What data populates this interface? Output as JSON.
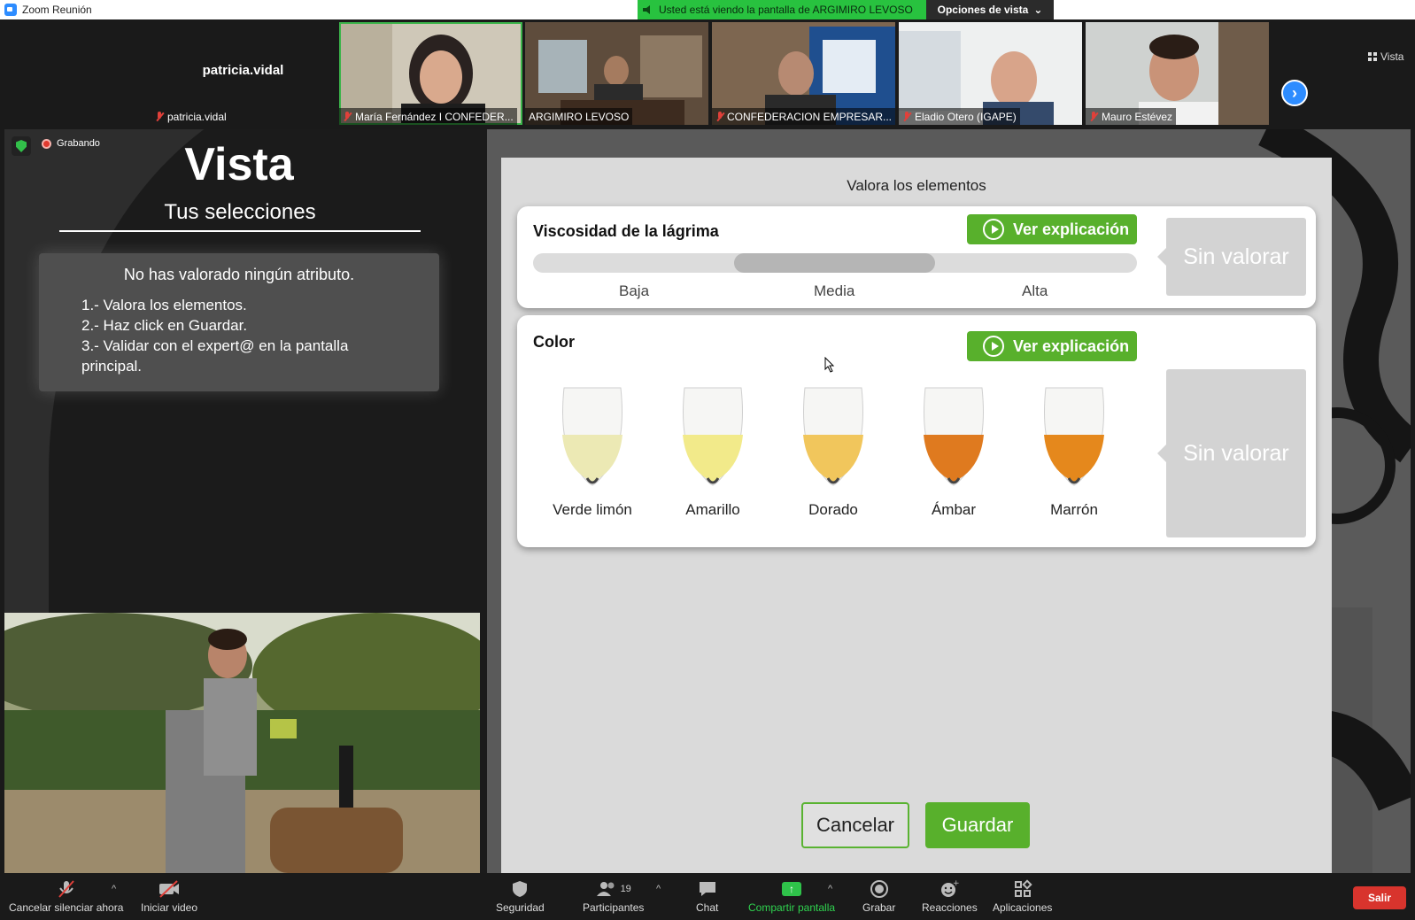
{
  "window": {
    "title": "Zoom Reunión"
  },
  "banner": {
    "text": "Usted está viendo la pantalla de ARGIMIRO LEVOSO",
    "view_options": "Opciones de vista"
  },
  "gallery": {
    "self_name": "patricia.vidal",
    "self_label": "patricia.vidal",
    "participants": [
      "María Fernández I CONFEDER...",
      "ARGIMIRO LEVOSO",
      "CONFEDERACION EMPRESAR...",
      "Eladio Otero (IGAPE)",
      "Mauro Estévez"
    ],
    "view_label": "Vista"
  },
  "recording": {
    "label": "Grabando"
  },
  "left_panel": {
    "title": "Vista",
    "subtitle": "Tus selecciones",
    "info_headline": "No has valorado ningún atributo.",
    "steps": [
      "1.- Valora los elementos.",
      "2.- Haz click en Guardar.",
      "3.- Validar con el expert@ en la pantalla principal."
    ]
  },
  "right_panel": {
    "title": "Valora los elementos",
    "viscosity": {
      "title": "Viscosidad de la lágrima",
      "explain_button": "Ver explicación",
      "status": "Sin valorar",
      "levels": [
        "Baja",
        "Media",
        "Alta"
      ]
    },
    "color": {
      "title": "Color",
      "explain_button": "Ver explicación",
      "status": "Sin valorar",
      "options": [
        {
          "label": "Verde limón",
          "hex": "#ece9b4"
        },
        {
          "label": "Amarillo",
          "hex": "#f2ea8a"
        },
        {
          "label": "Dorado",
          "hex": "#f1c65c"
        },
        {
          "label": "Ámbar",
          "hex": "#df7a1f"
        },
        {
          "label": "Marrón",
          "hex": "#e5881c"
        }
      ]
    },
    "cancel_button": "Cancelar",
    "save_button": "Guardar"
  },
  "toolbar": {
    "mute": "Cancelar silenciar ahora",
    "video": "Iniciar video",
    "security": "Seguridad",
    "participants": "Participantes",
    "participants_count": "19",
    "chat": "Chat",
    "share": "Compartir pantalla",
    "record": "Grabar",
    "reactions": "Reacciones",
    "apps": "Aplicaciones",
    "leave": "Salir"
  },
  "colors": {
    "accent_green": "#58b02c",
    "share_green": "#2fd34f",
    "zoom_blue": "#2d8cff",
    "leave_red": "#d8342d"
  }
}
